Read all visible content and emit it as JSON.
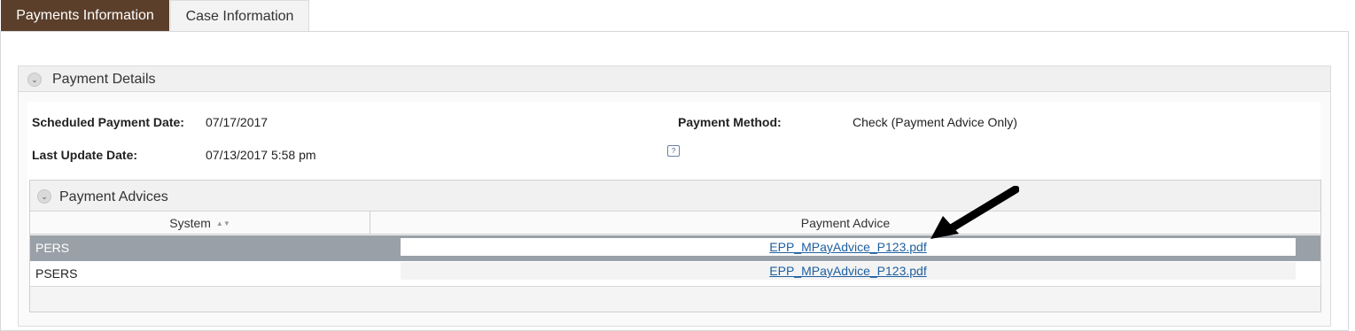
{
  "tabs": [
    {
      "label": "Payments Information",
      "active": true
    },
    {
      "label": "Case Information",
      "active": false
    }
  ],
  "payment_details": {
    "title": "Payment Details",
    "scheduled_label": "Scheduled Payment Date:",
    "scheduled_value": "07/17/2017",
    "method_label": "Payment Method:",
    "method_value": "Check (Payment Advice Only)",
    "update_label": "Last Update Date:",
    "update_value": "07/13/2017 5:58 pm",
    "help_icon": "help-comment-icon"
  },
  "payment_advices": {
    "title": "Payment Advices",
    "columns": [
      "System",
      "Payment Advice"
    ],
    "rows": [
      {
        "system": "PERS",
        "advice": "EPP_MPayAdvice_P123.pdf",
        "selected": true
      },
      {
        "system": "PSERS",
        "advice": "EPP_MPayAdvice_P123.pdf",
        "selected": false
      }
    ]
  },
  "colors": {
    "tab_active_bg": "#5b3f2b",
    "selected_row_bg": "#9aa0a7",
    "link": "#1f5fa0"
  }
}
